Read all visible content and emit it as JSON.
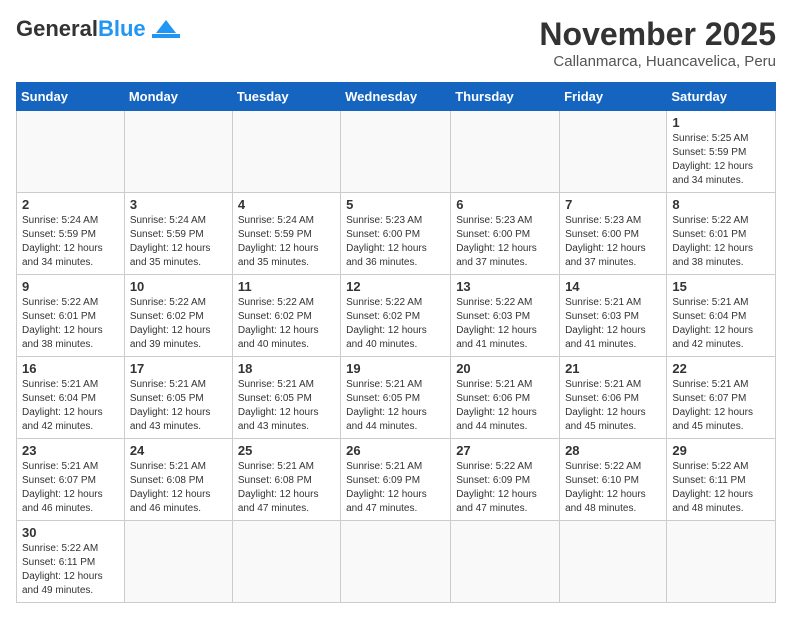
{
  "header": {
    "logo": {
      "text_general": "General",
      "text_blue": "Blue"
    },
    "title": "November 2025",
    "location": "Callanmarca, Huancavelica, Peru"
  },
  "weekdays": [
    "Sunday",
    "Monday",
    "Tuesday",
    "Wednesday",
    "Thursday",
    "Friday",
    "Saturday"
  ],
  "weeks": [
    [
      {
        "date": "",
        "info": ""
      },
      {
        "date": "",
        "info": ""
      },
      {
        "date": "",
        "info": ""
      },
      {
        "date": "",
        "info": ""
      },
      {
        "date": "",
        "info": ""
      },
      {
        "date": "",
        "info": ""
      },
      {
        "date": "1",
        "info": "Sunrise: 5:25 AM\nSunset: 5:59 PM\nDaylight: 12 hours and 34 minutes."
      }
    ],
    [
      {
        "date": "2",
        "info": "Sunrise: 5:24 AM\nSunset: 5:59 PM\nDaylight: 12 hours and 34 minutes."
      },
      {
        "date": "3",
        "info": "Sunrise: 5:24 AM\nSunset: 5:59 PM\nDaylight: 12 hours and 35 minutes."
      },
      {
        "date": "4",
        "info": "Sunrise: 5:24 AM\nSunset: 5:59 PM\nDaylight: 12 hours and 35 minutes."
      },
      {
        "date": "5",
        "info": "Sunrise: 5:23 AM\nSunset: 6:00 PM\nDaylight: 12 hours and 36 minutes."
      },
      {
        "date": "6",
        "info": "Sunrise: 5:23 AM\nSunset: 6:00 PM\nDaylight: 12 hours and 37 minutes."
      },
      {
        "date": "7",
        "info": "Sunrise: 5:23 AM\nSunset: 6:00 PM\nDaylight: 12 hours and 37 minutes."
      },
      {
        "date": "8",
        "info": "Sunrise: 5:22 AM\nSunset: 6:01 PM\nDaylight: 12 hours and 38 minutes."
      }
    ],
    [
      {
        "date": "9",
        "info": "Sunrise: 5:22 AM\nSunset: 6:01 PM\nDaylight: 12 hours and 38 minutes."
      },
      {
        "date": "10",
        "info": "Sunrise: 5:22 AM\nSunset: 6:02 PM\nDaylight: 12 hours and 39 minutes."
      },
      {
        "date": "11",
        "info": "Sunrise: 5:22 AM\nSunset: 6:02 PM\nDaylight: 12 hours and 40 minutes."
      },
      {
        "date": "12",
        "info": "Sunrise: 5:22 AM\nSunset: 6:02 PM\nDaylight: 12 hours and 40 minutes."
      },
      {
        "date": "13",
        "info": "Sunrise: 5:22 AM\nSunset: 6:03 PM\nDaylight: 12 hours and 41 minutes."
      },
      {
        "date": "14",
        "info": "Sunrise: 5:21 AM\nSunset: 6:03 PM\nDaylight: 12 hours and 41 minutes."
      },
      {
        "date": "15",
        "info": "Sunrise: 5:21 AM\nSunset: 6:04 PM\nDaylight: 12 hours and 42 minutes."
      }
    ],
    [
      {
        "date": "16",
        "info": "Sunrise: 5:21 AM\nSunset: 6:04 PM\nDaylight: 12 hours and 42 minutes."
      },
      {
        "date": "17",
        "info": "Sunrise: 5:21 AM\nSunset: 6:05 PM\nDaylight: 12 hours and 43 minutes."
      },
      {
        "date": "18",
        "info": "Sunrise: 5:21 AM\nSunset: 6:05 PM\nDaylight: 12 hours and 43 minutes."
      },
      {
        "date": "19",
        "info": "Sunrise: 5:21 AM\nSunset: 6:05 PM\nDaylight: 12 hours and 44 minutes."
      },
      {
        "date": "20",
        "info": "Sunrise: 5:21 AM\nSunset: 6:06 PM\nDaylight: 12 hours and 44 minutes."
      },
      {
        "date": "21",
        "info": "Sunrise: 5:21 AM\nSunset: 6:06 PM\nDaylight: 12 hours and 45 minutes."
      },
      {
        "date": "22",
        "info": "Sunrise: 5:21 AM\nSunset: 6:07 PM\nDaylight: 12 hours and 45 minutes."
      }
    ],
    [
      {
        "date": "23",
        "info": "Sunrise: 5:21 AM\nSunset: 6:07 PM\nDaylight: 12 hours and 46 minutes."
      },
      {
        "date": "24",
        "info": "Sunrise: 5:21 AM\nSunset: 6:08 PM\nDaylight: 12 hours and 46 minutes."
      },
      {
        "date": "25",
        "info": "Sunrise: 5:21 AM\nSunset: 6:08 PM\nDaylight: 12 hours and 47 minutes."
      },
      {
        "date": "26",
        "info": "Sunrise: 5:21 AM\nSunset: 6:09 PM\nDaylight: 12 hours and 47 minutes."
      },
      {
        "date": "27",
        "info": "Sunrise: 5:22 AM\nSunset: 6:09 PM\nDaylight: 12 hours and 47 minutes."
      },
      {
        "date": "28",
        "info": "Sunrise: 5:22 AM\nSunset: 6:10 PM\nDaylight: 12 hours and 48 minutes."
      },
      {
        "date": "29",
        "info": "Sunrise: 5:22 AM\nSunset: 6:11 PM\nDaylight: 12 hours and 48 minutes."
      }
    ],
    [
      {
        "date": "30",
        "info": "Sunrise: 5:22 AM\nSunset: 6:11 PM\nDaylight: 12 hours and 49 minutes."
      },
      {
        "date": "",
        "info": ""
      },
      {
        "date": "",
        "info": ""
      },
      {
        "date": "",
        "info": ""
      },
      {
        "date": "",
        "info": ""
      },
      {
        "date": "",
        "info": ""
      },
      {
        "date": "",
        "info": ""
      }
    ]
  ]
}
